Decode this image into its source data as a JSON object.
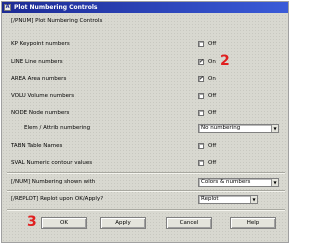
{
  "window": {
    "title": "Plot Numbering Controls",
    "icon": "A"
  },
  "header_text": "[/PNUM]  Plot Numbering Controls",
  "options": [
    {
      "label": "KP   Keypoint numbers",
      "checked": false,
      "state": "Off"
    },
    {
      "label": "LINE  Line numbers",
      "checked": true,
      "state": "On"
    },
    {
      "label": "AREA  Area numbers",
      "checked": true,
      "state": "On"
    },
    {
      "label": "VOLU  Volume numbers",
      "checked": false,
      "state": "Off"
    },
    {
      "label": "NODE  Node numbers",
      "checked": false,
      "state": "Off"
    }
  ],
  "elem_attrib": {
    "label": "Elem / Attrib numbering",
    "value": "No numbering"
  },
  "extra_options": [
    {
      "label": "TABN  Table Names",
      "checked": false,
      "state": "Off"
    },
    {
      "label": "SVAL  Numeric contour values",
      "checked": false,
      "state": "Off"
    }
  ],
  "num_shown": {
    "label": "[/NUM]  Numbering shown with",
    "value": "Colors & numbers"
  },
  "replot": {
    "label": "[/REPLOT]  Replot upon OK/Apply?",
    "value": "Replot"
  },
  "buttons": {
    "ok": "OK",
    "apply": "Apply",
    "cancel": "Cancel",
    "help": "Help"
  },
  "annotations": {
    "step2": "2",
    "step3": "3"
  },
  "colors": {
    "annotation": "#e02020",
    "titlebar": "#1c2a94"
  }
}
